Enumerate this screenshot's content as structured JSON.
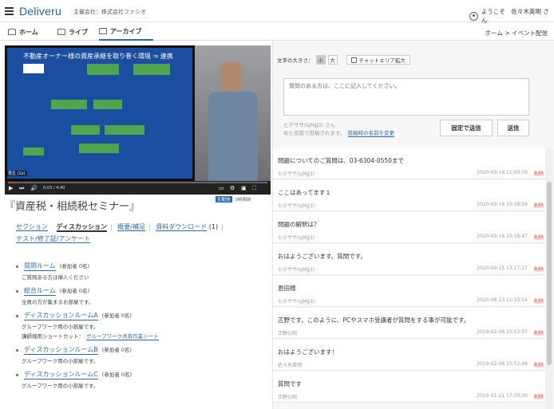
{
  "header": {
    "logo": "Deliveru",
    "organizer": "主催会社：株式会社ファシオ",
    "welcome": "ようこそ　佐々木英明 さん"
  },
  "nav": {
    "items": [
      {
        "label": "ホーム",
        "icon": "home-icon"
      },
      {
        "label": "ライブ",
        "icon": "camera-icon"
      },
      {
        "label": "アーカイブ",
        "icon": "film-icon",
        "active": true
      }
    ],
    "breadcrumb": "ホーム > イベント配信"
  },
  "video": {
    "slide_title": "不動産オーナー様の資産承継を取り巻く環境 ⇒ 連携",
    "time": "0:03 / 4:40",
    "badge": "再生 (1x)",
    "progress": 0.01,
    "under_tag": "生配信",
    "under_text": "0時間前"
  },
  "session": {
    "title": "『資産税・相続税セミナー』"
  },
  "tabs": {
    "section": "セクション",
    "discussion": "ディスカッション",
    "overview": "概要/補足",
    "download": "資料ダウンロード",
    "download_count": "(1)",
    "test": "テスト/修了証/アンケート"
  },
  "rooms": [
    {
      "name": "質問ルーム",
      "count": "(参加者 0名)",
      "desc": "ご質問ある方は挿入ください",
      "shortcut_label": "",
      "shortcut_link": ""
    },
    {
      "name": "総合ルーム",
      "count": "(参加者 0名)",
      "desc": "全員の方が集まるお部屋です。",
      "shortcut_label": "",
      "shortcut_link": ""
    },
    {
      "name": "ディスカッションルームA",
      "count": "(参加者 0名)",
      "desc": "グループワーク用の小部屋です。",
      "shortcut_label": "講師様用ショートカット：",
      "shortcut_link": "グループワーク共有作業シート"
    },
    {
      "name": "ディスカッションルームB",
      "count": "(参加者 0名)",
      "desc": "グループワーク用の小部屋です。",
      "shortcut_label": "",
      "shortcut_link": ""
    },
    {
      "name": "ディスカッションルームC",
      "count": "(参加者 0名)",
      "desc": "グループワーク用の小部屋です。",
      "shortcut_label": "",
      "shortcut_link": ""
    }
  ],
  "chat": {
    "font_size_label": "文字の大きさ：",
    "font_small": "小",
    "font_large": "大",
    "expand_label": "チャットエリア拡大",
    "placeholder": "質問のある方は、ここに記入してください。",
    "nickname_line1": "ヒデササ(sJMJJ3) さん",
    "nickname_line2": "めた名前で投稿されます。",
    "change_name": "投稿時の名前を変更",
    "fixed_send": "固定で送信",
    "send": "送信",
    "delete_label": "削除",
    "messages": [
      {
        "text": "問題についてのご質問は、03-6304-0550まで",
        "author": "ヒデササ(sJMJJ3)",
        "date": "2020-09-18 11:00:09"
      },
      {
        "text": "ここはあってます１",
        "author": "ヒデササ(sJMJJ3)",
        "date": "2020-09-18 10:58:56"
      },
      {
        "text": "問題の解釈は？",
        "author": "ヒデササ(sJMJJ3)",
        "date": "2020-09-18 10:58:47"
      },
      {
        "text": "おはようございます。質問です。",
        "author": "ヒデササ(sJMJJ3)",
        "date": "2020-09-15 13:17:27"
      },
      {
        "text": "恩田様",
        "author": "ヒデササ(sJMJJ3)",
        "date": "2020-08-13 11:33:54"
      },
      {
        "text": "正野です。このように、PCやスマホ受講者が質問をする事が可能です。",
        "author": "正野公昭",
        "date": "2019-02-08 10:53:07"
      },
      {
        "text": "おはようございます！",
        "author": "佐々木英明",
        "date": "2019-02-08 10:52:46"
      },
      {
        "text": "質問です",
        "author": "正野公昭",
        "date": "2019-01-21 17:20:00"
      }
    ]
  }
}
